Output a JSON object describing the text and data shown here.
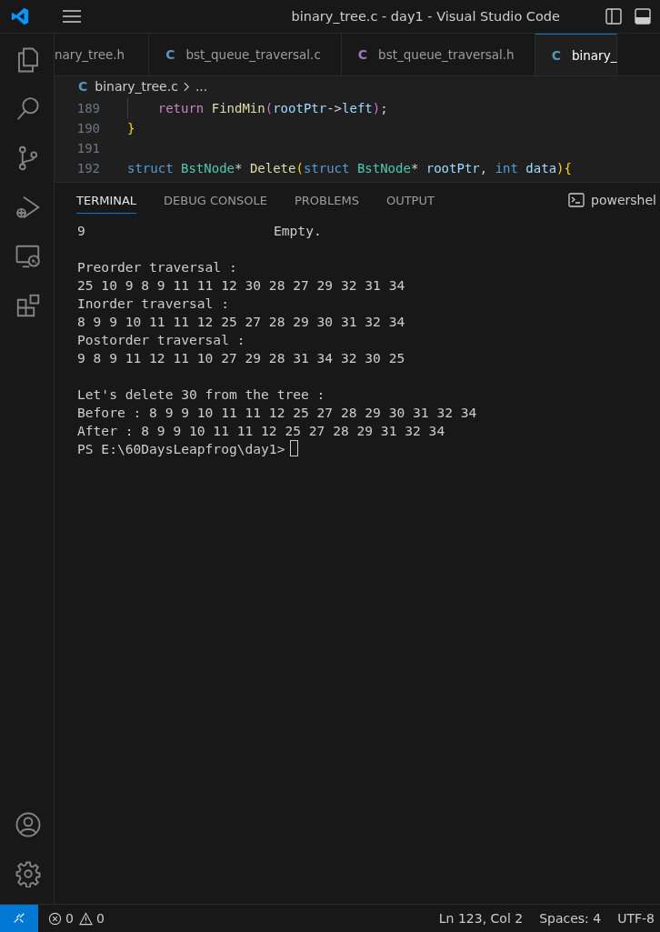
{
  "window": {
    "title": "binary_tree.c - day1 - Visual Studio Code"
  },
  "activity_bar": {
    "top": [
      {
        "kind": "files",
        "selected": false
      },
      {
        "kind": "search",
        "selected": false
      },
      {
        "kind": "source-control",
        "selected": false
      },
      {
        "kind": "run",
        "selected": false
      },
      {
        "kind": "remote",
        "selected": false
      },
      {
        "kind": "extensions",
        "selected": false
      }
    ],
    "bottom": [
      {
        "kind": "account"
      },
      {
        "kind": "settings"
      }
    ]
  },
  "tabs": [
    {
      "label": "nary_tree.h",
      "selected": false
    },
    {
      "label": "bst_queue_traversal.c",
      "icon_letter": "C",
      "color": "#519aba",
      "selected": false
    },
    {
      "label": "bst_queue_traversal.h",
      "icon_letter": "C",
      "color": "#a074c4",
      "selected": false
    },
    {
      "label": "binary_",
      "icon_letter": "C",
      "color": "#519aba",
      "selected": true
    }
  ],
  "breadcrumb": {
    "icon_letter": "C",
    "file": "binary_tree.c",
    "rest": "..."
  },
  "editor": {
    "lines": [
      {
        "number": "189",
        "indent_guide": true,
        "tokens": [
          {
            "kind": "keyword",
            "text": "    return"
          },
          {
            "kind": "function",
            "text": " FindMin"
          },
          {
            "kind": "paren",
            "text": "("
          },
          {
            "kind": "variable",
            "text": "rootPtr"
          },
          {
            "kind": "plain",
            "text": "->"
          },
          {
            "kind": "variable",
            "text": "left"
          },
          {
            "kind": "paren",
            "text": ")"
          },
          {
            "kind": "plain",
            "text": ";"
          }
        ]
      },
      {
        "number": "190",
        "tokens": [
          {
            "kind": "brace",
            "text": "}"
          }
        ]
      },
      {
        "number": "191"
      },
      {
        "number": "192",
        "tokens": [
          {
            "kind": "type",
            "text": "struct"
          },
          {
            "kind": "class",
            "text": " BstNode"
          },
          {
            "kind": "plain",
            "text": "* "
          },
          {
            "kind": "function",
            "text": "Delete"
          },
          {
            "kind": "brace",
            "text": "("
          },
          {
            "kind": "type",
            "text": "struct"
          },
          {
            "kind": "class",
            "text": " BstNode"
          },
          {
            "kind": "plain",
            "text": "* "
          },
          {
            "kind": "variable",
            "text": "rootPtr"
          },
          {
            "kind": "plain",
            "text": ", "
          },
          {
            "kind": "type",
            "text": "int"
          },
          {
            "kind": "variable",
            "text": " data"
          },
          {
            "kind": "brace",
            "text": "){"
          }
        ]
      }
    ]
  },
  "panel": {
    "tabs": [
      {
        "label": "TERMINAL",
        "selected": true
      },
      {
        "label": "DEBUG CONSOLE",
        "selected": false
      },
      {
        "label": "PROBLEMS",
        "selected": false
      },
      {
        "label": "OUTPUT",
        "selected": false
      }
    ],
    "shell": "powershel"
  },
  "terminal": {
    "lines": [
      {
        "kind": "columns",
        "text": "9",
        "column_2": "Empty."
      },
      {
        "kind": "blank"
      },
      {
        "kind": "output",
        "text": "Preorder traversal :"
      },
      {
        "kind": "output",
        "text": "25 10 9 8 9 11 11 12 30 28 27 29 32 31 34"
      },
      {
        "kind": "output",
        "text": "Inorder traversal :"
      },
      {
        "kind": "output",
        "text": "8 9 9 10 11 11 12 25 27 28 29 30 31 32 34"
      },
      {
        "kind": "output",
        "text": "Postorder traversal :"
      },
      {
        "kind": "output",
        "text": "9 8 9 11 12 11 10 27 29 28 31 34 32 30 25"
      },
      {
        "kind": "blank"
      },
      {
        "kind": "output",
        "text": "Let's delete 30 from the tree :"
      },
      {
        "kind": "output",
        "text": "Before : 8 9 9 10 11 11 12 25 27 28 29 30 31 32 34"
      },
      {
        "kind": "output",
        "text": "After : 8 9 9 10 11 11 12 25 27 28 29 31 32 34"
      },
      {
        "kind": "prompt",
        "text": "PS E:\\60DaysLeapfrog\\day1>"
      }
    ]
  },
  "status_bar": {
    "errors": "0",
    "warnings": "0",
    "items": [
      "Ln 123, Col 2",
      "Spaces: 4",
      "UTF-8"
    ]
  }
}
